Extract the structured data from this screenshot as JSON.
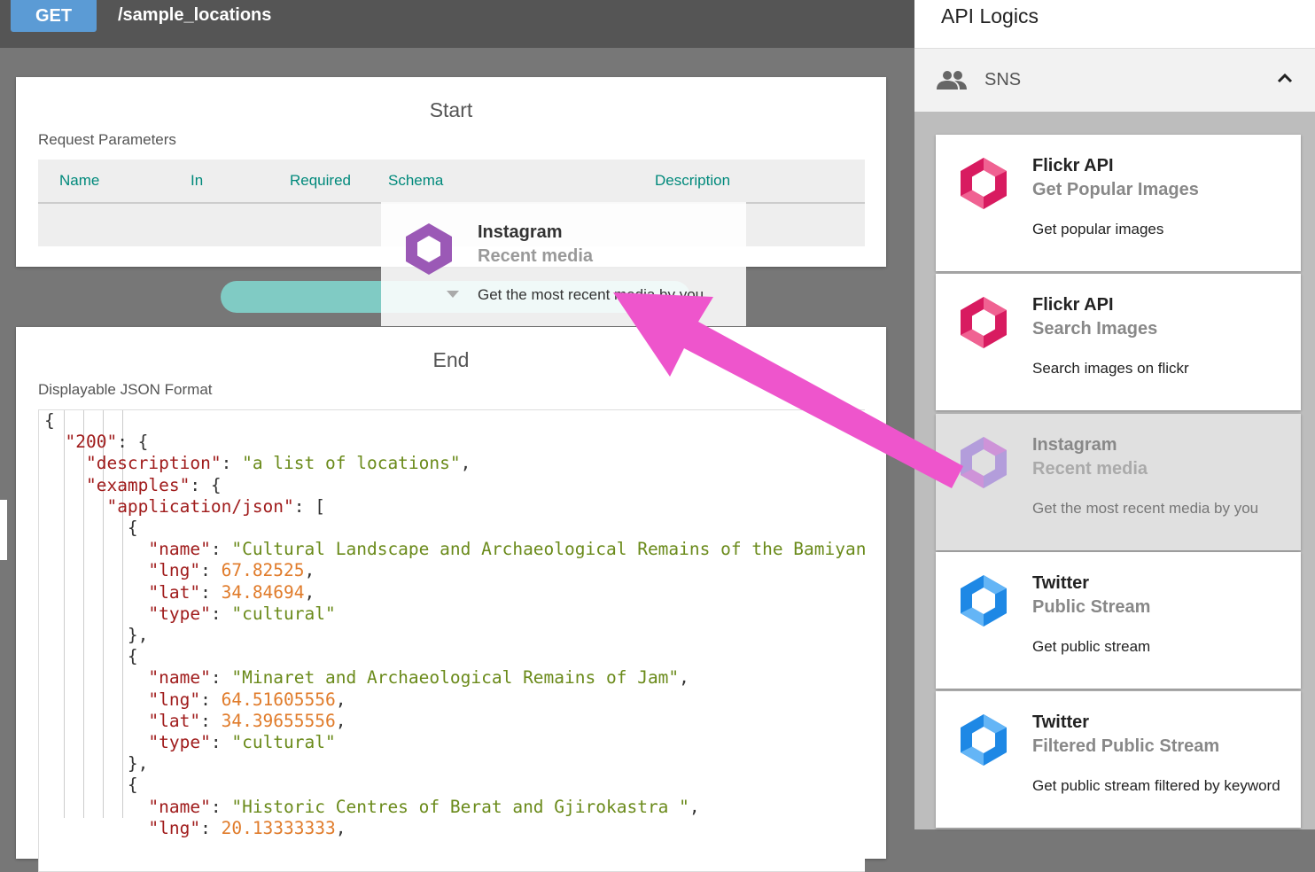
{
  "topbar": {
    "method": "GET",
    "path": "/sample_locations"
  },
  "start": {
    "title": "Start",
    "params_label": "Request Parameters",
    "columns": [
      "Name",
      "In",
      "Required",
      "Schema",
      "Description"
    ]
  },
  "end": {
    "title": "End",
    "format_label": "Displayable JSON Format"
  },
  "json_lines": [
    "{",
    "  \"200\": {",
    "    \"description\": \"a list of locations\",",
    "    \"examples\": {",
    "      \"application/json\": [",
    "        {",
    "          \"name\": \"Cultural Landscape and Archaeological Remains of the Bamiyan Valle",
    "          \"lng\": 67.82525,",
    "          \"lat\": 34.84694,",
    "          \"type\": \"cultural\"",
    "        },",
    "        {",
    "          \"name\": \"Minaret and Archaeological Remains of Jam\",",
    "          \"lng\": 64.51605556,",
    "          \"lat\": 34.39655556,",
    "          \"type\": \"cultural\"",
    "        },",
    "        {",
    "          \"name\": \"Historic Centres of Berat and Gjirokastra \",",
    "          \"lng\": 20.13333333,"
  ],
  "dragging": {
    "name": "Instagram",
    "method": "Recent media",
    "desc": "Get the most recent media by you",
    "logo_colors": [
      "#9b59b6",
      "#c27bd6"
    ]
  },
  "right_panel": {
    "title": "API Logics",
    "section": "SNS",
    "cards": [
      {
        "name": "Flickr API",
        "method": "Get Popular Images",
        "desc": "Get popular images",
        "logo_colors": [
          "#d81b60",
          "#f06292"
        ],
        "ghosted": false
      },
      {
        "name": "Flickr API",
        "method": "Search Images",
        "desc": "Search images on flickr",
        "logo_colors": [
          "#d81b60",
          "#f06292"
        ],
        "ghosted": false
      },
      {
        "name": "Instagram",
        "method": "Recent media",
        "desc": "Get the most recent media by you",
        "logo_colors": [
          "#b39ddb",
          "#ce93d8"
        ],
        "ghosted": true
      },
      {
        "name": "Twitter",
        "method": "Public Stream",
        "desc": "Get public stream",
        "logo_colors": [
          "#1e88e5",
          "#64b5f6"
        ],
        "ghosted": false
      },
      {
        "name": "Twitter",
        "method": "Filtered Public Stream",
        "desc": "Get public stream filtered by keyword",
        "logo_colors": [
          "#1e88e5",
          "#64b5f6"
        ],
        "ghosted": false
      }
    ]
  },
  "annotation": {
    "arrow_color": "#ee55cc"
  }
}
